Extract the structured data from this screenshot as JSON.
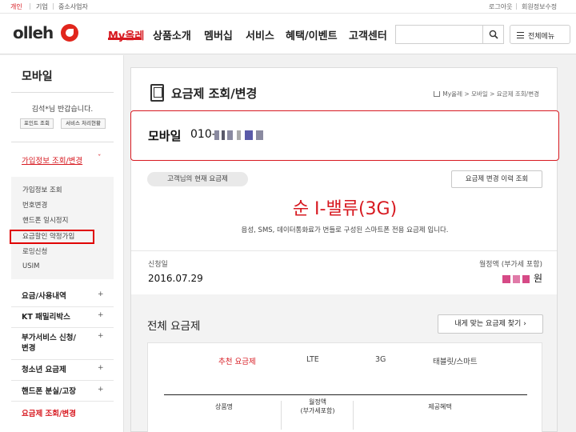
{
  "topbar": {
    "segments": [
      "개인",
      "기업",
      "중소사업자"
    ],
    "utils": [
      "로그아웃",
      "회원정보수정"
    ]
  },
  "header": {
    "logo_text": "olleh",
    "nav": [
      "My올레",
      "상품소개",
      "멤버십",
      "서비스",
      "혜택/이벤트",
      "고객센터"
    ],
    "active_nav": "My올레",
    "search_placeholder": "",
    "all_menu_label": "전체메뉴"
  },
  "sidebar": {
    "title": "모바일",
    "greeting": "김석*님 반갑습니다.",
    "buttons": [
      "포인트 조회",
      "서비스 처리현황"
    ],
    "active_section": "가입정보 조회/변경",
    "sub_items": [
      "가입정보 조회",
      "번호변경",
      "핸드폰 일시정지",
      "요금할인 약정가입",
      "로밍신청",
      "USIM"
    ],
    "highlighted_sub_item": "요금할인 약정가입",
    "items": [
      "요금/사용내역",
      "KT 패밀리박스",
      "부가서비스 신청/\n변경",
      "청소년 요금제",
      "핸드폰 분실/고장"
    ],
    "current_item": "요금제 조회/변경"
  },
  "main": {
    "title": "요금제 조회/변경",
    "breadcrumb": "My올레 > 모바일 > 요금제 조회/변경",
    "line_label": "모바일",
    "number_prefix": "010-",
    "current_plan_pill": "고객님의 현재 요금제",
    "history_button": "요금제 변경 이력 조회",
    "plan_name": "순 I-밸류(3G)",
    "plan_desc": "음성, SMS, 데이터통화료가 번들로 구성된 스마트폰 전용 요금제 입니다.",
    "signup_label": "신청일",
    "signup_date": "2016.07.29",
    "monthly_label": "월정액 (부가세 포함)",
    "monthly_unit": "원",
    "all_plans_title": "전체 요금제",
    "find_button": "내게 맞는 요금제 찾기",
    "tabs": [
      "추천 요금제",
      "LTE",
      "3G",
      "태블릿/스마트"
    ],
    "active_tab": "추천 요금제",
    "table_headers": [
      "상품명",
      "월정액\n(부가세포함)",
      "제공혜택"
    ]
  },
  "colors": {
    "brand": "#d71920",
    "highlight_box": "#e00000"
  }
}
